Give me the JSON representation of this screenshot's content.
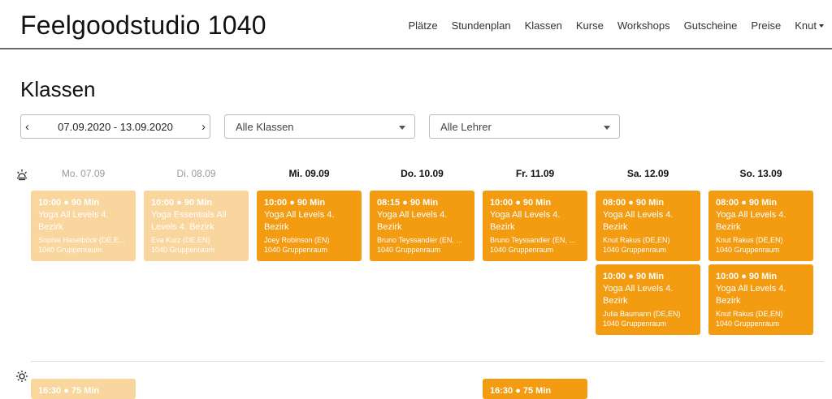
{
  "header": {
    "brand": "Feelgoodstudio 1040",
    "nav": [
      "Plätze",
      "Stundenplan",
      "Klassen",
      "Kurse",
      "Workshops",
      "Gutscheine",
      "Preise",
      "Knut"
    ]
  },
  "page_title": "Klassen",
  "filters": {
    "date_range": "07.09.2020 - 13.09.2020",
    "prev_arrow": "‹",
    "next_arrow": "›",
    "class_select": "Alle Klassen",
    "teacher_select": "Alle Lehrer"
  },
  "days": [
    "Mo. 07.09",
    "Di. 08.09",
    "Mi. 09.09",
    "Do. 10.09",
    "Fr. 11.09",
    "Sa. 12.09",
    "So. 13.09"
  ],
  "icons": {
    "morning": "sunrise-icon",
    "afternoon": "sun-icon"
  },
  "colors": {
    "past": "#f9d69d",
    "future": "#f39c12"
  },
  "classes": [
    {
      "time": "10:00 ● 90 Min",
      "name": "Yoga All Levels 4. Bezirk",
      "teacher": "Sophie Haselböck (DE,E...",
      "room": "1040 Gruppenraum"
    },
    {
      "time": "10:00 ● 90 Min",
      "name": "Yoga Essentials All Levels 4. Bezirk",
      "teacher": "Eva Kurz (DE,EN)",
      "room": "1040 Gruppenraum"
    },
    {
      "time": "10:00 ● 90 Min",
      "name": "Yoga All Levels 4. Bezirk",
      "teacher": "Joey Robinson (EN)",
      "room": "1040 Gruppenraum"
    },
    {
      "time": "08:15 ● 90 Min",
      "name": "Yoga All Levels 4. Bezirk",
      "teacher": "Bruno Teyssandier (EN, ...",
      "room": "1040 Gruppenraum"
    },
    {
      "time": "10:00 ● 90 Min",
      "name": "Yoga All Levels 4. Bezirk",
      "teacher": "Bruno Teyssandier (EN, ...",
      "room": "1040 Gruppenraum"
    },
    {
      "time": "08:00 ● 90 Min",
      "name": "Yoga All Levels 4. Bezirk",
      "teacher": "Knut Rakus (DE,EN)",
      "room": "1040 Gruppenraum"
    },
    {
      "time": "08:00 ● 90 Min",
      "name": "Yoga All Levels 4. Bezirk",
      "teacher": "Knut Rakus (DE,EN)",
      "room": "1040 Gruppenraum"
    },
    {
      "time": "10:00 ● 90 Min",
      "name": "Yoga All Levels 4. Bezirk",
      "teacher": "Julia Baumann (DE,EN)",
      "room": "1040 Gruppenraum"
    },
    {
      "time": "10:00 ● 90 Min",
      "name": "Yoga All Levels 4. Bezirk",
      "teacher": "Knut Rakus (DE,EN)",
      "room": "1040 Gruppenraum"
    },
    {
      "time": "16:30 ● 75 Min"
    },
    {
      "time": "16:30 ● 75 Min"
    }
  ]
}
